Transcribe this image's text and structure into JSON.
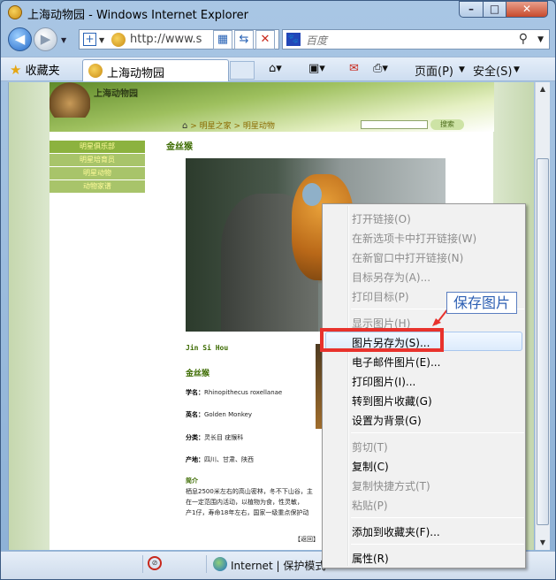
{
  "window": {
    "title": "上海动物园 - Windows Internet Explorer",
    "controls": {
      "minimize": "–",
      "maximize": "□",
      "close": "✕"
    }
  },
  "navbar": {
    "address": "http://www.s",
    "search_placeholder": "百度",
    "search_provider_icon": "baidu-paw-icon"
  },
  "commandbar": {
    "favorites_label": "收藏夹",
    "tab_label": "上海动物园",
    "page_menu": "页面(P)",
    "safety_menu": "安全(S)"
  },
  "page": {
    "logo_text": "上海动物园",
    "breadcrumb": [
      "明星之家",
      "明星动物"
    ],
    "site_search_button": "搜索",
    "left_nav": [
      "明星俱乐部",
      "明星培育员",
      "明星动物",
      "动物家谱"
    ],
    "heading": "金丝猴",
    "latin_name": "Jin Si Hou",
    "cn_name": "金丝猴",
    "info": [
      {
        "label": "学名：",
        "value": "Rhinopithecus roxellanae"
      },
      {
        "label": "英名：",
        "value": "Golden Monkey"
      },
      {
        "label": "分类：",
        "value": "灵长目 疣猴科"
      },
      {
        "label": "产地：",
        "value": "四川、甘肃、陕西"
      }
    ],
    "intro_title": "简介",
    "intro_text": "栖息2500米左右的高山密林，冬不下山谷，主\n在一定范围内活动，以植物为食，性灵敏，\n产1仔，寿命18年左右，国家一级重点保护动",
    "return_link": "【返回】"
  },
  "statusbar": {
    "zone_text": "Internet | 保护模式"
  },
  "context_menu": {
    "items": [
      {
        "label": "打开链接(O)",
        "disabled": true
      },
      {
        "label": "在新选项卡中打开链接(W)",
        "disabled": true
      },
      {
        "label": "在新窗口中打开链接(N)",
        "disabled": true
      },
      {
        "label": "目标另存为(A)...",
        "disabled": true
      },
      {
        "label": "打印目标(P)",
        "disabled": true
      },
      {
        "label": "显示图片(H)",
        "disabled": true
      },
      {
        "label": "图片另存为(S)...",
        "disabled": false
      },
      {
        "label": "电子邮件图片(E)...",
        "disabled": false
      },
      {
        "label": "打印图片(I)...",
        "disabled": false
      },
      {
        "label": "转到图片收藏(G)",
        "disabled": false
      },
      {
        "label": "设置为背景(G)",
        "disabled": false
      },
      {
        "label": "剪切(T)",
        "disabled": true
      },
      {
        "label": "复制(C)",
        "disabled": false
      },
      {
        "label": "复制快捷方式(T)",
        "disabled": true
      },
      {
        "label": "粘贴(P)",
        "disabled": true
      },
      {
        "label": "添加到收藏夹(F)...",
        "disabled": false
      },
      {
        "label": "属性(R)",
        "disabled": false
      }
    ]
  },
  "annotation": {
    "callout_text": "保存图片",
    "highlight_color": "#e8322c",
    "callout_color": "#2d5fb3"
  }
}
